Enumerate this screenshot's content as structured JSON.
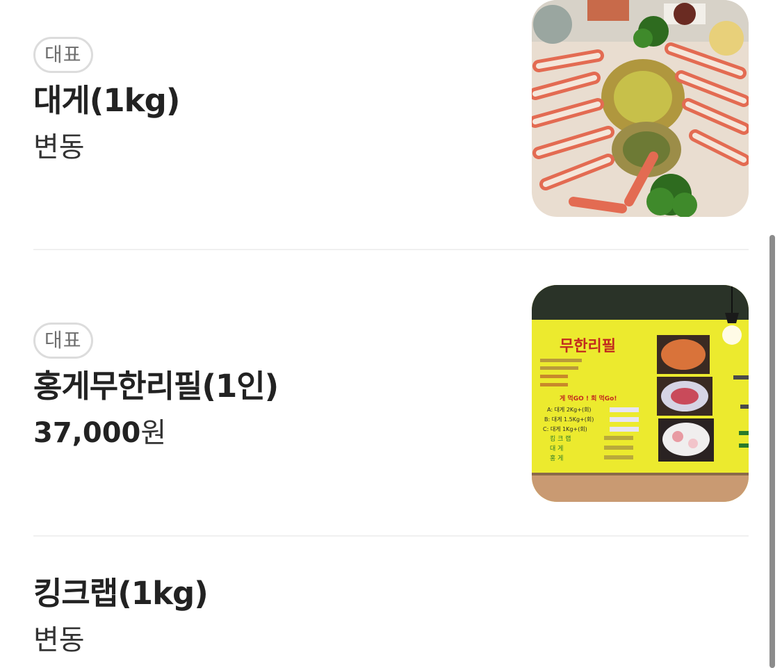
{
  "menu": {
    "items": [
      {
        "badge": "대표",
        "name": "대게(1kg)",
        "price": "변동",
        "image_icon": "snow-crab-platter-photo"
      },
      {
        "badge": "대표",
        "name": "홍게무한리필(1인)",
        "price_amount": "37,000",
        "price_unit": "원",
        "image_icon": "menu-board-photo",
        "image_text": {
          "headline": "무한리필",
          "subhead": "게 먹GO ! 회 먹Go!",
          "options": [
            "A: 대게 2Kg+(회)",
            "B: 대게 1.5Kg+(회)",
            "C: 대게 1Kg+(회)"
          ],
          "seasonal": [
            "킹 크 랩",
            "대  게",
            "홍  게"
          ]
        }
      },
      {
        "name": "킹크랩(1kg)",
        "price": "변동"
      }
    ]
  },
  "colors": {
    "badge_border": "#dcdcdc",
    "badge_text": "#6e6e6e",
    "divider": "#f0f0f0",
    "scrollbar": "#8c8c8c",
    "menu_board_yellow": "#ecea2e"
  }
}
